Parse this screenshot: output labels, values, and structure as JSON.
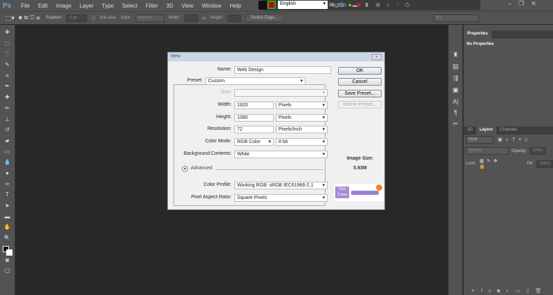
{
  "app": {
    "logo": "Ps",
    "menu": [
      "File",
      "Edit",
      "Image",
      "Layer",
      "Type",
      "Select",
      "Filter",
      "3D",
      "View",
      "Window",
      "Help"
    ]
  },
  "options": {
    "feather_label": "Feather:",
    "feather_value": "0 px",
    "antialias": "Anti-alias",
    "style_label": "Style:",
    "style_value": "Normal",
    "width_label": "Width:",
    "height_label": "Height:",
    "refine_edge": "Refine Edge...",
    "workspace": "3D"
  },
  "tray": {
    "language": "English",
    "ghost_text": "nglish"
  },
  "dialog": {
    "title": "New",
    "name_label": "Name:",
    "name_value": "Web Design",
    "preset_label": "Preset:",
    "preset_value": "Custom",
    "size_label": "Size:",
    "width_label": "Width:",
    "width_value": "1920",
    "width_unit": "Pixels",
    "height_label": "Height:",
    "height_value": "1080",
    "height_unit": "Pixels",
    "resolution_label": "Resolution:",
    "resolution_value": "72",
    "resolution_unit": "Pixels/Inch",
    "color_mode_label": "Color Mode:",
    "color_mode_value": "RGB Color",
    "bit_depth": "8 bit",
    "background_label": "Background Contents:",
    "background_value": "White",
    "advanced_label": "Advanced",
    "color_profile_label": "Color Profile:",
    "color_profile_value": "Working RGB:  sRGB IEC61966-2.1",
    "pixel_aspect_label": "Pixel Aspect Ratio:",
    "pixel_aspect_value": "Square Pixels",
    "ok": "OK",
    "cancel": "Cancel",
    "save_preset": "Save Preset...",
    "delete_preset": "Delete Preset...",
    "image_size_label": "Image Size:",
    "image_size_value": "5.93M",
    "watermark": "Tech Tunes"
  },
  "properties": {
    "tab": "Properties",
    "text": "No Properties"
  },
  "layers": {
    "tabs": [
      "3D",
      "Layers",
      "Channels"
    ],
    "kind": "Kind",
    "blend": "Normal",
    "opacity_label": "Opacity:",
    "opacity_value": "100%",
    "lock_label": "Lock:",
    "fill_label": "Fill:",
    "fill_value": "100%"
  }
}
